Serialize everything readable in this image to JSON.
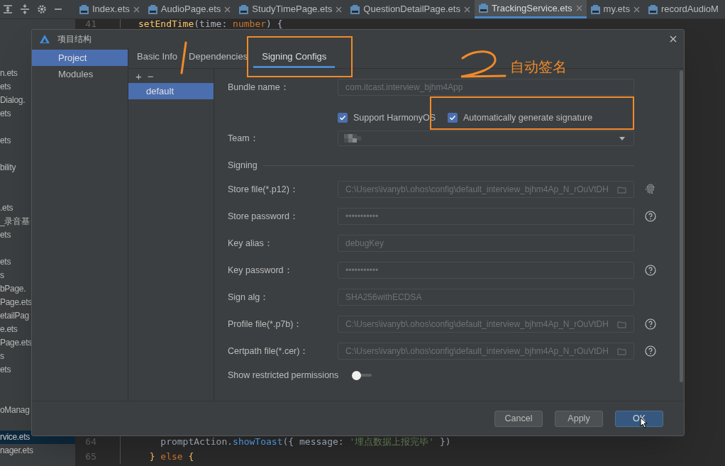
{
  "editor_tabs": [
    {
      "label": "Index.ets",
      "selected": false
    },
    {
      "label": "AudioPage.ets",
      "selected": false
    },
    {
      "label": "StudyTimePage.ets",
      "selected": false
    },
    {
      "label": "QuestionDetailPage.ets",
      "selected": false
    },
    {
      "label": "TrackingService.ets",
      "selected": true
    },
    {
      "label": "my.ets",
      "selected": false
    },
    {
      "label": "recordAudioM",
      "selected": false
    }
  ],
  "project_tree": [
    {
      "kind": "file",
      "label": "n.ets",
      "selected": false
    },
    {
      "kind": "file",
      "label": "ets",
      "selected": false
    },
    {
      "kind": "file",
      "label": "Dialog.",
      "selected": false
    },
    {
      "kind": "file",
      "label": "ets",
      "selected": false
    },
    {
      "kind": "gap"
    },
    {
      "kind": "file",
      "label": "ets",
      "selected": false
    },
    {
      "kind": "gap"
    },
    {
      "kind": "file",
      "label": "bility",
      "selected": false
    },
    {
      "kind": "gap"
    },
    {
      "kind": "gap"
    },
    {
      "kind": "file",
      "label": ".ets",
      "selected": false
    },
    {
      "kind": "file",
      "label": "_录音基",
      "selected": false
    },
    {
      "kind": "file",
      "label": "ets",
      "selected": false
    },
    {
      "kind": "gap"
    },
    {
      "kind": "file",
      "label": "ets",
      "selected": false
    },
    {
      "kind": "file",
      "label": "s",
      "selected": false
    },
    {
      "kind": "file",
      "label": "bPage.",
      "selected": false
    },
    {
      "kind": "file",
      "label": "Page.ets",
      "selected": false
    },
    {
      "kind": "file",
      "label": "etailPag",
      "selected": false
    },
    {
      "kind": "file",
      "label": "e.ets",
      "selected": false
    },
    {
      "kind": "file",
      "label": "Page.ets",
      "selected": false
    },
    {
      "kind": "file",
      "label": "s",
      "selected": false
    },
    {
      "kind": "file",
      "label": "ets",
      "selected": false
    },
    {
      "kind": "gap"
    },
    {
      "kind": "gap"
    },
    {
      "kind": "file",
      "label": "oManag",
      "selected": false
    },
    {
      "kind": "gap"
    },
    {
      "kind": "file",
      "label": "rvice.ets",
      "selected": true
    },
    {
      "kind": "file",
      "label": "nager.ets",
      "selected": false
    }
  ],
  "code_top": [
    {
      "number": "41",
      "tokens": [
        {
          "kind": "function",
          "text": "setEndTime"
        },
        {
          "kind": "plain",
          "text": "(time: "
        },
        {
          "kind": "keyword",
          "text": "number"
        },
        {
          "kind": "plain",
          "text": ") {"
        }
      ]
    }
  ],
  "code_bottom": [
    {
      "number": "64",
      "tokens": [
        {
          "kind": "plain",
          "text": "    promptAction."
        },
        {
          "kind": "method",
          "text": "showToast"
        },
        {
          "kind": "plain",
          "text": "({ message: "
        },
        {
          "kind": "string",
          "text": "'埋点数据上报完毕'"
        },
        {
          "kind": "plain",
          "text": " })"
        }
      ]
    },
    {
      "number": "65",
      "tokens": [
        {
          "kind": "function",
          "text": "  }"
        },
        {
          "kind": "keyword",
          "text": " else"
        },
        {
          "kind": "function",
          "text": " {"
        }
      ]
    }
  ],
  "dialog": {
    "title": "项目结构",
    "nav": [
      {
        "label": "Project",
        "selected": true
      },
      {
        "label": "Modules",
        "selected": false
      }
    ],
    "tabs": [
      {
        "label": "Basic Info",
        "selected": false
      },
      {
        "label": "Dependencies",
        "selected": false
      },
      {
        "label": "Signing Configs",
        "selected": true
      }
    ],
    "config_toolbar": [
      "+",
      "−"
    ],
    "configs": [
      {
        "label": "default",
        "selected": true
      }
    ],
    "form": [
      {
        "kind": "text",
        "label": "Bundle name：",
        "value": "com.itcast.interview_bjhm4App"
      },
      {
        "kind": "checkboxes",
        "options": [
          {
            "label": "Support HarmonyOS",
            "checked": true
          },
          {
            "label": "Automatically generate signature",
            "checked": true
          }
        ]
      },
      {
        "kind": "dropdown",
        "label": "Team："
      },
      {
        "kind": "section",
        "label": "Signing"
      },
      {
        "kind": "file",
        "label": "Store file(*.p12)：",
        "value": "C:\\Users\\ivanyb\\.ohos\\config\\default_interview_bjhm4Ap_N_rOuVtDH",
        "aside": {
          "kind": "fingerprint"
        }
      },
      {
        "kind": "text",
        "label": "Store password：",
        "value": "•••••••••••",
        "aside": {
          "kind": "help"
        }
      },
      {
        "kind": "text",
        "label": "Key alias：",
        "value": "debugKey"
      },
      {
        "kind": "text",
        "label": "Key password：",
        "value": "•••••••••••",
        "aside": {
          "kind": "help"
        }
      },
      {
        "kind": "text",
        "label": "Sign alg：",
        "value": "SHA256withECDSA"
      },
      {
        "kind": "file",
        "label": "Profile file(*.p7b)：",
        "value": "C:\\Users\\ivanyb\\.ohos\\config\\default_interview_bjhm4Ap_N_rOuVtDH",
        "aside": {
          "kind": "help"
        }
      },
      {
        "kind": "file",
        "label": "Certpath file(*.cer)：",
        "value": "C:\\Users\\ivanyb\\.ohos\\config\\default_interview_bjhm4Ap_N_rOuVtDH",
        "aside": {
          "kind": "help"
        }
      },
      {
        "kind": "toggle",
        "label": "Show restricted permissions",
        "on": false
      }
    ],
    "buttons": [
      {
        "label": "Cancel",
        "default": false
      },
      {
        "label": "Apply",
        "default": false
      },
      {
        "label": "OK",
        "default": true
      }
    ]
  },
  "annotation": {
    "text": "自动签名"
  }
}
